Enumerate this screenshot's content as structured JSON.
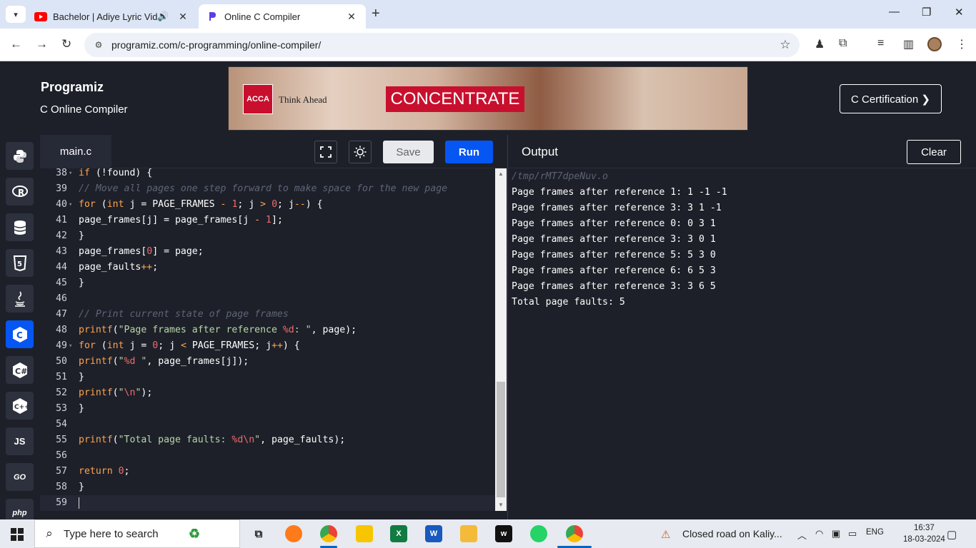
{
  "browser": {
    "tabs": [
      {
        "title": "Bachelor | Adiye Lyric Video",
        "icon": "youtube-icon",
        "audio": true
      },
      {
        "title": "Online C Compiler",
        "icon": "programiz-icon",
        "active": true
      }
    ],
    "url": "programiz.com/c-programming/online-compiler/"
  },
  "site": {
    "logo": "Programiz",
    "subtitle": "C Online Compiler",
    "certification_button": "C Certification ❯",
    "ad": {
      "brand": "ACCA",
      "tagline": "Think Ahead",
      "cta": "CONCENTRATE"
    }
  },
  "languages": [
    "python",
    "r",
    "sql",
    "html",
    "java",
    "c",
    "csharp",
    "cpp",
    "JS",
    "GO",
    "php"
  ],
  "editor": {
    "filename": "main.c",
    "save_label": "Save",
    "run_label": "Run",
    "lines": [
      {
        "n": "38",
        "fold": true
      },
      {
        "n": "39"
      },
      {
        "n": "40",
        "fold": true
      },
      {
        "n": "41"
      },
      {
        "n": "42"
      },
      {
        "n": "43"
      },
      {
        "n": "44"
      },
      {
        "n": "45"
      },
      {
        "n": "46"
      },
      {
        "n": "47"
      },
      {
        "n": "48"
      },
      {
        "n": "49",
        "fold": true
      },
      {
        "n": "50"
      },
      {
        "n": "51"
      },
      {
        "n": "52"
      },
      {
        "n": "53"
      },
      {
        "n": "54"
      },
      {
        "n": "55"
      },
      {
        "n": "56"
      },
      {
        "n": "57"
      },
      {
        "n": "58"
      },
      {
        "n": "59",
        "current": true
      }
    ]
  },
  "output": {
    "title": "Output",
    "clear_label": "Clear",
    "lines": [
      "/tmp/rMT7dpeNuv.o",
      "Page frames after reference 1: 1 -1 -1",
      "Page frames after reference 3: 3 1 -1",
      "Page frames after reference 0: 0 3 1",
      "Page frames after reference 3: 3 0 1",
      "Page frames after reference 5: 5 3 0",
      "Page frames after reference 6: 6 5 3",
      "Page frames after reference 3: 3 6 5",
      "Total page faults: 5"
    ]
  },
  "taskbar": {
    "search_placeholder": "Type here to search",
    "notification": "Closed road on Kaliy...",
    "language": "ENG",
    "time": "16:37",
    "date": "18-03-2024"
  },
  "colors": {
    "accent": "#0556f3",
    "background": "#1d2029",
    "keyword": "#ffa34e",
    "string": "#b8d6a8",
    "number": "#ef6b6b"
  }
}
